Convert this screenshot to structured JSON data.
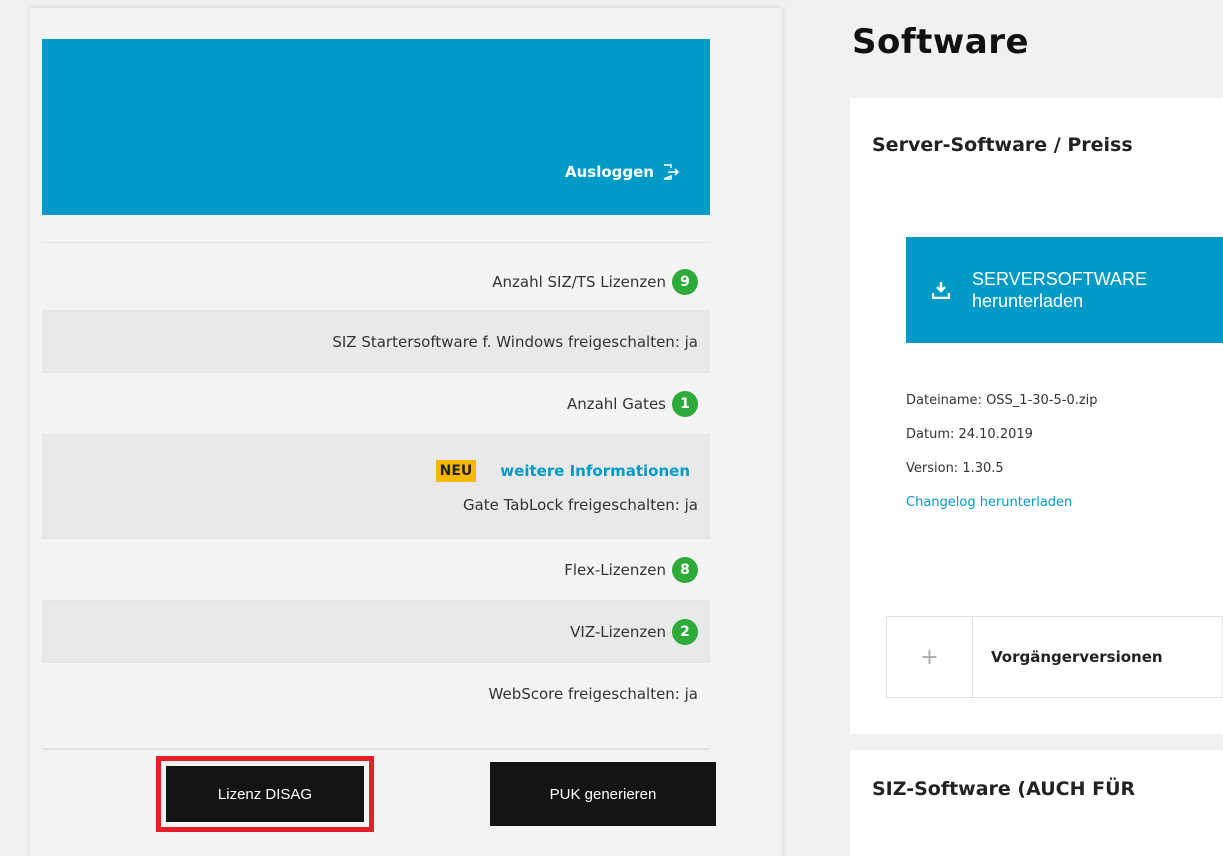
{
  "header": {
    "logout_label": "Ausloggen"
  },
  "license_info": {
    "siz_ts_label": "Anzahl SIZ/TS Lizenzen",
    "siz_ts_count": "9",
    "starter_label": "SIZ Startersoftware f. Windows freigeschalten: ja",
    "gates_label": "Anzahl Gates",
    "gates_count": "1",
    "neu_badge": "NEU",
    "more_info_link": "weitere Informationen",
    "tablock_label": "Gate TabLock freigeschalten: ja",
    "flex_label": "Flex-Lizenzen",
    "flex_count": "8",
    "viz_label": "VIZ-Lizenzen",
    "viz_count": "2",
    "webscore_label": "WebScore freigeschalten: ja"
  },
  "actions": {
    "lizenz_disag": "Lizenz DISAG",
    "puk_generate": "PUK generieren"
  },
  "software": {
    "page_title": "Software",
    "server_section_title": "Server-Software / Preiss",
    "download_line1": "SERVERSOFTWARE",
    "download_line2": "herunterladen",
    "filename": "Dateiname: OSS_1-30-5-0.zip",
    "date": "Datum: 24.10.2019",
    "version": "Version: 1.30.5",
    "changelog_link": "Changelog herunterladen",
    "accordion_plus": "+",
    "previous_versions": "Vorgängerversionen",
    "siz_section_title": "SIZ-Software (AUCH FÜR"
  },
  "colors": {
    "accent": "#009ac7",
    "badge_green": "#2eaa3a",
    "neu_yellow": "#f5b800",
    "highlight_red": "#e3202a"
  },
  "icons": {
    "logout": "logout-icon",
    "download": "download-icon",
    "plus": "plus-icon"
  }
}
